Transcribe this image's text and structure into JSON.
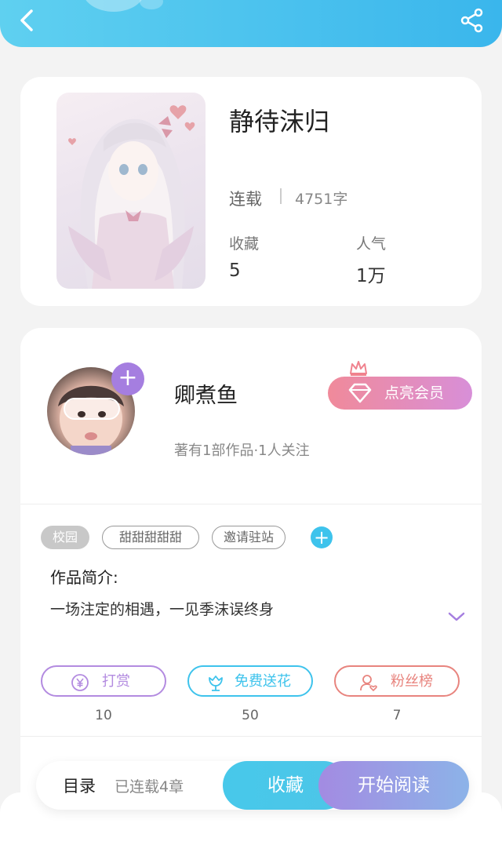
{
  "book": {
    "title": "静待沫归",
    "status": "连载",
    "word_count": "4751字",
    "collect_label": "收藏",
    "collect_count": "5",
    "popularity_label": "人气",
    "popularity_count": "1万"
  },
  "author": {
    "name": "卿煮鱼",
    "info": "著有1部作品·1人关注",
    "follow_symbol": "+",
    "vip_label": "点亮会员"
  },
  "tags": [
    "校园",
    "甜甜甜甜甜",
    "邀请驻站"
  ],
  "tag_add_symbol": "+",
  "intro": {
    "title": "作品简介:",
    "text": "一场注定的相遇，一见季沫误终身"
  },
  "actions": [
    {
      "label": "打赏",
      "count": "10",
      "color": "#b38be0"
    },
    {
      "label": "免费送花",
      "count": "50",
      "color": "#3ec3ec"
    },
    {
      "label": "粉丝榜",
      "count": "7",
      "color": "#e8847e"
    }
  ],
  "bottom": {
    "toc_label": "目录",
    "chapters": "已连载4章",
    "collect_button": "收藏",
    "read_button": "开始阅读"
  },
  "colors": {
    "top_bar": "#3ab6ec",
    "accent_purple": "#a57ee0",
    "accent_blue": "#3ec3ec",
    "vip_pink": "#f08a9a"
  },
  "icons": [
    "back-arrow-icon",
    "share-icon",
    "crown-icon",
    "diamond-icon",
    "yen-coin-icon",
    "flower-icon",
    "fan-ranking-icon",
    "chevron-down-icon"
  ]
}
